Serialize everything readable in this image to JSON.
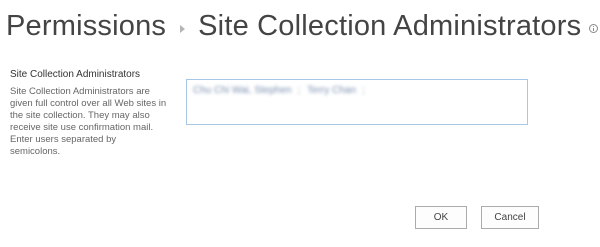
{
  "header": {
    "breadcrumb_root": "Permissions",
    "page_title": "Site Collection Administrators"
  },
  "section": {
    "heading": "Site Collection Administrators",
    "description": "Site Collection Administrators are given full control over all Web sites in the site collection. They may also receive site use confirmation mail. Enter users separated by semicolons."
  },
  "people_picker": {
    "users": [
      {
        "label": "Chu Chi Wai, Stephen"
      },
      {
        "label": "Terry Chan"
      }
    ]
  },
  "buttons": {
    "ok": "OK",
    "cancel": "Cancel"
  }
}
